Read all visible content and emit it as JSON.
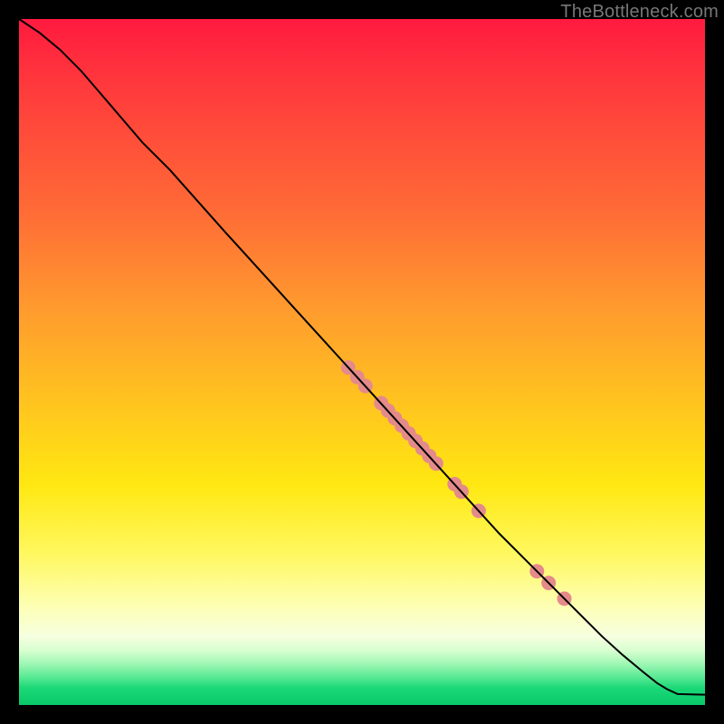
{
  "watermark": "TheBottleneck.com",
  "chart_data": {
    "type": "line",
    "title": "",
    "xlabel": "",
    "ylabel": "",
    "xlim": [
      0,
      100
    ],
    "ylim": [
      0,
      100
    ],
    "grid": false,
    "legend": false,
    "curve": {
      "name": "curve",
      "color": "#000000",
      "x": [
        0,
        3,
        6,
        9,
        12,
        15,
        18,
        22,
        26,
        30,
        35,
        40,
        45,
        50,
        55,
        60,
        65,
        70,
        75,
        80,
        85,
        88,
        91,
        93,
        94.5,
        96,
        100
      ],
      "y": [
        100,
        98,
        95.5,
        92.5,
        89,
        85.5,
        82,
        78,
        73.5,
        69,
        63.5,
        58,
        52.5,
        47,
        41.5,
        36,
        30.5,
        25,
        20,
        15,
        10,
        7.3,
        4.8,
        3.2,
        2.3,
        1.6,
        1.5
      ]
    },
    "markers": {
      "name": "points",
      "color": "#e48a8a",
      "radius": 8,
      "points": [
        {
          "x": 48.0,
          "y": 49.2
        },
        {
          "x": 49.3,
          "y": 47.8
        },
        {
          "x": 50.5,
          "y": 46.5
        },
        {
          "x": 52.8,
          "y": 44.0
        },
        {
          "x": 53.8,
          "y": 42.9
        },
        {
          "x": 54.8,
          "y": 41.8
        },
        {
          "x": 55.8,
          "y": 40.7
        },
        {
          "x": 56.8,
          "y": 39.6
        },
        {
          "x": 57.8,
          "y": 38.5
        },
        {
          "x": 58.8,
          "y": 37.4
        },
        {
          "x": 59.8,
          "y": 36.3
        },
        {
          "x": 60.8,
          "y": 35.2
        },
        {
          "x": 63.5,
          "y": 32.2
        },
        {
          "x": 64.5,
          "y": 31.1
        },
        {
          "x": 67.0,
          "y": 28.3
        },
        {
          "x": 75.5,
          "y": 19.5
        },
        {
          "x": 77.2,
          "y": 17.8
        },
        {
          "x": 79.5,
          "y": 15.5
        }
      ]
    }
  }
}
